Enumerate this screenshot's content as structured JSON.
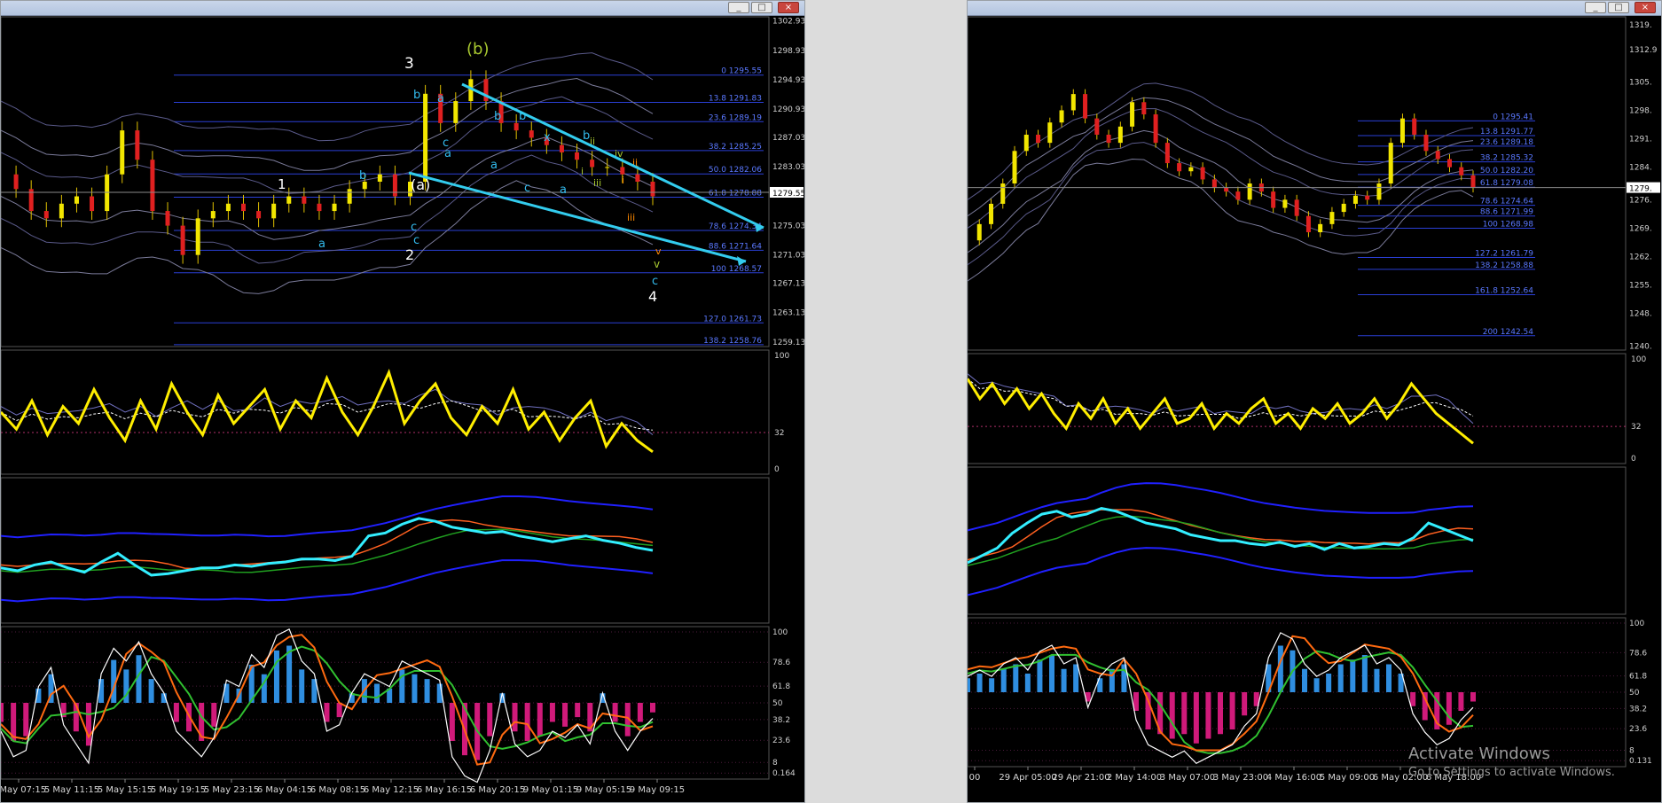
{
  "windows": [
    {
      "name": "left",
      "buttons": [
        "_",
        "□",
        "×"
      ]
    },
    {
      "name": "right",
      "buttons": [
        "_",
        "□",
        "×"
      ]
    }
  ],
  "watermark": {
    "line1": "Activate Windows",
    "line2": "Go to Settings to activate Windows."
  },
  "chart_data": [
    {
      "type": "line",
      "panel": "left-price",
      "title": "",
      "price_scale_labels": [
        "1302.93",
        "1298.93",
        "1294.93",
        "1290.93",
        "1287.03",
        "1283.03",
        "1279.55",
        "1275.03",
        "1271.03",
        "1267.13",
        "1263.13",
        "1259.13"
      ],
      "price_scale_values": [
        1302.93,
        1298.93,
        1294.93,
        1290.93,
        1287.03,
        1283.03,
        1279.55,
        1275.03,
        1271.03,
        1267.13,
        1263.13,
        1259.13
      ],
      "current_price": "1279.55",
      "ylim": [
        1258.5,
        1303.5
      ],
      "xlim": [
        0,
        640
      ],
      "close": [
        1282,
        1280,
        1277,
        1276,
        1278,
        1279,
        1277,
        1282,
        1288,
        1284,
        1277,
        1275,
        1271,
        1276,
        1277,
        1278,
        1277,
        1276,
        1278,
        1279,
        1278,
        1277,
        1278,
        1280,
        1281,
        1282,
        1279,
        1281,
        1293,
        1289,
        1292,
        1295,
        1292,
        1289,
        1288,
        1287,
        1286,
        1285,
        1284,
        1283,
        1283,
        1282,
        1281,
        1279
      ],
      "fib_levels": [
        {
          "label": "0 1295.55",
          "value": 1295.55
        },
        {
          "label": "13.8 1291.83",
          "value": 1291.83
        },
        {
          "label": "23.6 1289.19",
          "value": 1289.19
        },
        {
          "label": "38.2 1285.25",
          "value": 1285.25
        },
        {
          "label": "50.0 1282.06",
          "value": 1282.06
        },
        {
          "label": "61.8 1278.88",
          "value": 1278.88
        },
        {
          "label": "78.6 1274.34",
          "value": 1274.34
        },
        {
          "label": "88.6 1271.64",
          "value": 1271.64
        },
        {
          "label": "100 1268.57",
          "value": 1268.57
        },
        {
          "label": "127.0 1261.73",
          "value": 1261.73
        },
        {
          "label": "138.2 1258.76",
          "value": 1258.76
        }
      ],
      "wave_labels": [
        "3",
        "(b)",
        "1",
        "b",
        "a",
        "b",
        "a",
        "c",
        "(a)",
        "c",
        "2",
        "b",
        "a",
        "c",
        "b",
        "x",
        "a",
        "c",
        "a",
        "b",
        "ii",
        "iv",
        "i",
        "iii",
        "i",
        "ii",
        "iii",
        "v",
        "v",
        "c",
        "4"
      ],
      "x_tick_labels": [
        "5 May 07:15",
        "5 May 11:15",
        "5 May 15:15",
        "5 May 19:15",
        "5 May 23:15",
        "6 May 04:15",
        "6 May 08:15",
        "6 May 12:15",
        "6 May 16:15",
        "6 May 20:15",
        "9 May 01:15",
        "9 May 05:15",
        "9 May 09:15"
      ]
    },
    {
      "type": "line",
      "panel": "left-rsi",
      "ylim": [
        0,
        100
      ],
      "scale_labels": [
        "100",
        "32",
        "0"
      ],
      "values": [
        50,
        35,
        60,
        30,
        55,
        40,
        70,
        45,
        25,
        60,
        35,
        75,
        50,
        30,
        65,
        40,
        55,
        70,
        35,
        60,
        45,
        80,
        50,
        30,
        55,
        85,
        40,
        60,
        75,
        45,
        30,
        55,
        40,
        70,
        35,
        50,
        25,
        45,
        60,
        20,
        40,
        25,
        15
      ]
    },
    {
      "type": "line",
      "panel": "left-bands",
      "ylim": [
        0,
        100
      ],
      "values": [
        38,
        36,
        40,
        42,
        38,
        35,
        42,
        48,
        40,
        33,
        34,
        36,
        38,
        38,
        40,
        39,
        41,
        42,
        44,
        44,
        43,
        46,
        60,
        62,
        68,
        72,
        70,
        66,
        64,
        62,
        63,
        60,
        58,
        56,
        58,
        60,
        57,
        55,
        52,
        50
      ]
    },
    {
      "type": "bar",
      "panel": "left-osc",
      "ylim": [
        0,
        100
      ],
      "scale_labels": [
        "100",
        "78.6",
        "61.8",
        "50",
        "38.2",
        "23.6",
        "8",
        "0.164"
      ],
      "values": [
        -20,
        -40,
        -35,
        15,
        30,
        -15,
        -30,
        -45,
        25,
        45,
        35,
        50,
        25,
        10,
        -20,
        -30,
        -40,
        -25,
        20,
        15,
        40,
        30,
        55,
        60,
        35,
        25,
        -20,
        -15,
        10,
        25,
        20,
        15,
        35,
        30,
        25,
        20,
        -40,
        -55,
        -60,
        -35,
        10,
        -30,
        -40,
        -35,
        -20,
        -25,
        -15,
        -30,
        10,
        -20,
        -35,
        -20,
        -10
      ]
    },
    {
      "type": "line",
      "panel": "right-price",
      "price_scale_labels": [
        "1319.",
        "1312.9",
        "1305.",
        "1298.",
        "1291.",
        "1284.",
        "1279.",
        "1276.",
        "1269.",
        "1262.",
        "1255.",
        "1248.",
        "1240."
      ],
      "price_scale_values": [
        1319,
        1312.9,
        1305,
        1298,
        1291,
        1284,
        1279,
        1276,
        1269,
        1262,
        1255,
        1248,
        1240
      ],
      "current_price": "1279.",
      "ylim": [
        1239,
        1321
      ],
      "xlim": [
        0,
        495
      ],
      "close": [
        1266,
        1270,
        1275,
        1280,
        1288,
        1292,
        1290,
        1295,
        1298,
        1302,
        1296,
        1292,
        1290,
        1294,
        1300,
        1297,
        1290,
        1285,
        1283,
        1284,
        1281,
        1279,
        1278,
        1276,
        1280,
        1278,
        1274,
        1276,
        1272,
        1268,
        1270,
        1273,
        1275,
        1277,
        1276,
        1280,
        1290,
        1296,
        1292,
        1288,
        1286,
        1284,
        1282,
        1279
      ],
      "fib_levels": [
        {
          "label": "0 1295.41",
          "value": 1295.41
        },
        {
          "label": "13.8 1291.77",
          "value": 1291.77
        },
        {
          "label": "23.6 1289.18",
          "value": 1289.18
        },
        {
          "label": "38.2 1285.32",
          "value": 1285.32
        },
        {
          "label": "50.0 1282.20",
          "value": 1282.2
        },
        {
          "label": "61.8 1279.08",
          "value": 1279.08
        },
        {
          "label": "78.6 1274.64",
          "value": 1274.64
        },
        {
          "label": "88.6 1271.99",
          "value": 1271.99
        },
        {
          "label": "100 1268.98",
          "value": 1268.98
        },
        {
          "label": "127.2 1261.79",
          "value": 1261.79
        },
        {
          "label": "138.2 1258.88",
          "value": 1258.88
        },
        {
          "label": "161.8 1252.64",
          "value": 1252.64
        },
        {
          "label": "200 1242.54",
          "value": 1242.54
        }
      ],
      "x_tick_labels": [
        "00",
        "29 Apr 05:00",
        "29 Apr 21:00",
        "2 May 14:00",
        "3 May 07:00",
        "3 May 23:00",
        "4 May 16:00",
        "5 May 09:00",
        "6 May 02:00",
        "6 May 18:00"
      ]
    },
    {
      "type": "line",
      "panel": "right-rsi",
      "ylim": [
        0,
        100
      ],
      "scale_labels": [
        "100",
        "32",
        "0"
      ],
      "values": [
        80,
        60,
        75,
        55,
        70,
        50,
        65,
        45,
        30,
        55,
        40,
        60,
        35,
        50,
        30,
        45,
        60,
        35,
        40,
        55,
        30,
        45,
        35,
        50,
        60,
        35,
        45,
        30,
        50,
        40,
        55,
        35,
        45,
        60,
        40,
        55,
        75,
        60,
        45,
        35,
        25,
        15
      ]
    },
    {
      "type": "line",
      "panel": "right-bands",
      "ylim": [
        0,
        100
      ],
      "values": [
        35,
        40,
        45,
        55,
        62,
        68,
        70,
        66,
        68,
        72,
        70,
        66,
        62,
        60,
        58,
        54,
        52,
        50,
        50,
        48,
        47,
        49,
        46,
        48,
        44,
        48,
        45,
        46,
        48,
        47,
        52,
        62,
        58,
        54,
        50
      ]
    },
    {
      "type": "bar",
      "panel": "right-osc",
      "ylim": [
        0,
        100
      ],
      "scale_labels": [
        "100",
        "78.6",
        "61.8",
        "50",
        "38.2",
        "23.6",
        "8",
        "0.131"
      ],
      "values": [
        15,
        20,
        15,
        25,
        30,
        20,
        35,
        40,
        25,
        30,
        -10,
        15,
        25,
        30,
        -20,
        -40,
        -45,
        -50,
        -45,
        -55,
        -50,
        -45,
        -40,
        -25,
        -15,
        30,
        50,
        45,
        25,
        15,
        20,
        30,
        35,
        40,
        25,
        30,
        20,
        -15,
        -30,
        -40,
        -35,
        -20,
        -10
      ]
    }
  ]
}
